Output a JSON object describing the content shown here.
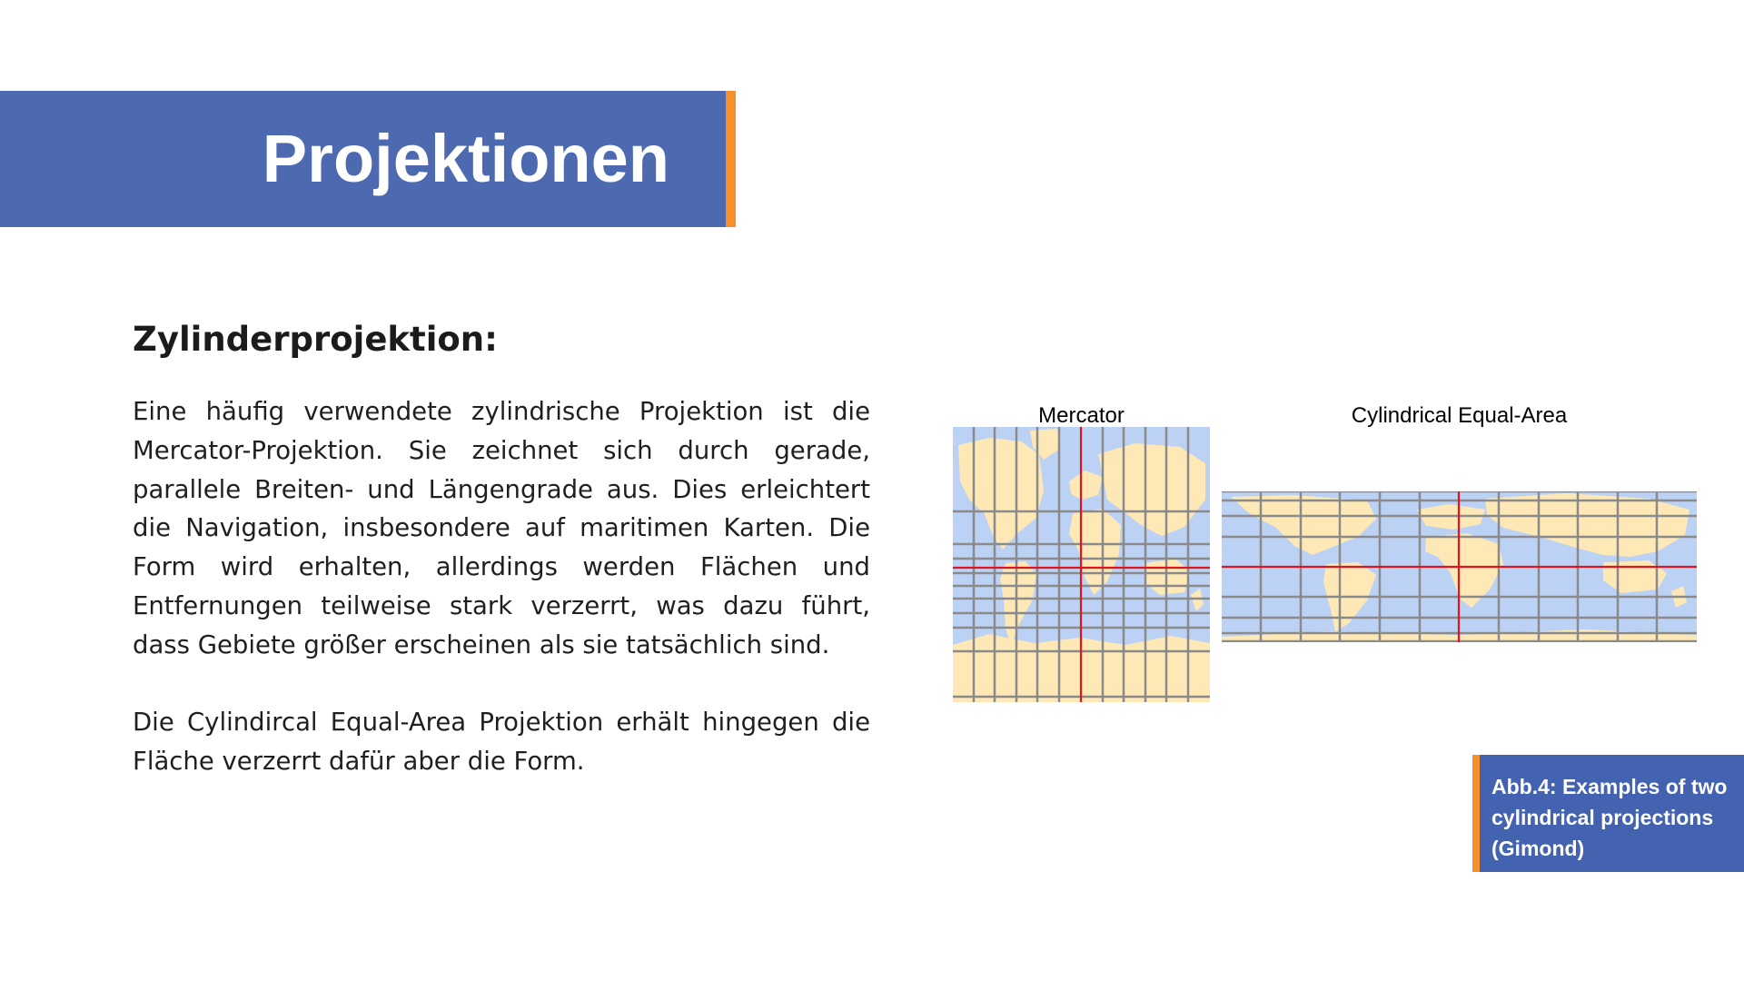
{
  "title": "Projektionen",
  "subheading": "Zylinderprojektion:",
  "paragraphs": [
    "Eine häufig verwendete zylindrische Projektion ist die Mercator-Projektion. Sie zeichnet sich durch gerade, parallele Breiten- und Längengrade aus. Dies erleichtert die Navigation, insbesondere auf maritimen Karten. Die Form wird erhalten, allerdings werden Flächen und Entfernungen teilweise stark verzerrt, was dazu führt, dass Gebiete größer erscheinen als sie tatsächlich sind.",
    "Die Cylindircal Equal-Area Projektion erhält hingegen die Fläche verzerrt dafür aber die Form."
  ],
  "figure": {
    "maps": [
      {
        "label": "Mercator"
      },
      {
        "label": "Cylindrical Equal-Area"
      }
    ],
    "caption": "Abb.4: Examples of two cylindrical projections (Gimond)"
  },
  "colors": {
    "banner": "#4d6ab1",
    "accent": "#f5902a",
    "caption_box": "#4362af",
    "ocean": "#bcd2f5",
    "land": "#fde8b6",
    "graticule": "#8a8a8a",
    "equator": "#e0141e"
  }
}
